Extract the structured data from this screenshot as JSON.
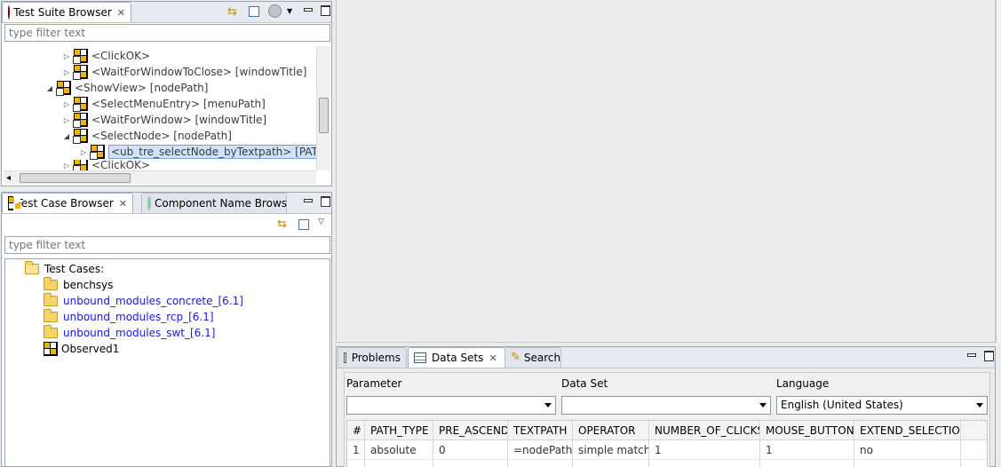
{
  "suite_browser": {
    "tab_label": "Test Suite Browser",
    "filter_placeholder": "type filter text",
    "tree": [
      {
        "text": "<ClickOK>",
        "indent": 2
      },
      {
        "text": "<WaitForWindowToClose> [windowTitle]",
        "indent": 2
      },
      {
        "text": "<ShowView> [nodePath]",
        "indent": 1
      },
      {
        "text": "<SelectMenuEntry> [menuPath]",
        "indent": 2
      },
      {
        "text": "<WaitForWindow> [windowTitle]",
        "indent": 2
      },
      {
        "text": "<SelectNode> [nodePath]",
        "indent": 2
      },
      {
        "text": "<ub_tre_selectNode_byTextpath> [PATH_T",
        "indent": 3
      },
      {
        "text": "<ClickOK>",
        "indent": 2
      }
    ]
  },
  "case_browser": {
    "tab_label": "Test Case Browser",
    "tab2_label": "Component Name Brows",
    "filter_placeholder": "type filter text",
    "root": "Test Cases:",
    "items": [
      {
        "text": "benchsys"
      },
      {
        "text": "unbound_modules_concrete_[6.1]"
      },
      {
        "text": "unbound_modules_rcp_[6.1]"
      },
      {
        "text": "unbound_modules_swt_[6.1]"
      },
      {
        "text": "Observed1"
      }
    ]
  },
  "bottom_panel": {
    "tabs": [
      "Problems",
      "Data Sets",
      "Search"
    ],
    "labels": {
      "parameter": "Parameter",
      "data_set": "Data Set",
      "language": "Language"
    },
    "language_value": "English (United States)",
    "columns": [
      "#",
      "PATH_TYPE",
      "PRE_ASCEND",
      "TEXTPATH",
      "OPERATOR",
      "NUMBER_OF_CLICKS",
      "MOUSE_BUTTON",
      "EXTEND_SELECTION"
    ],
    "rows": [
      [
        "1",
        "absolute",
        "0",
        "=nodePath",
        "simple match",
        "1",
        "1",
        "no"
      ]
    ]
  },
  "colors": {
    "link": "#1a1ad0",
    "selection": "#cde3fb"
  }
}
